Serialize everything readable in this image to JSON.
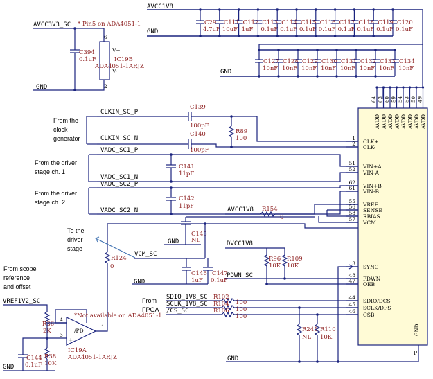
{
  "nets": {
    "avcc3v3_sc": "AVCC3V3_SC",
    "avcc1v8": "AVCC1V8",
    "avcc1v8_2": "AVCC1V8",
    "dvcc1v8": "DVCC1V8",
    "gnd": "GND",
    "clkin_p": "CLKIN_SC_P",
    "clkin_n": "CLKIN_SC_N",
    "vadc1_p": "VADC_SC1_P",
    "vadc1_n": "VADC_SC1_N",
    "vadc2_p": "VADC_SC2_P",
    "vadc2_n": "VADC_SC2_N",
    "vcm_sc": "VCM_SC",
    "pdwn_sc": "PDWN_SC",
    "sdio": "SDIO_1V8_SC",
    "sclk": "SCLK_1V8_SC",
    "cs": "/CS_SC",
    "vref1v2": "VREF1V2_SC"
  },
  "notes": {
    "pin5": "* Pin5 on ADA4051-1",
    "not_available": "*Not available on ADA4051-1",
    "clock_gen": [
      "From the",
      "clock",
      "generator"
    ],
    "driver1": [
      "From the driver",
      "stage ch. 1"
    ],
    "driver2": [
      "From the driver",
      "stage ch. 2"
    ],
    "to_driver": [
      "To the",
      "driver",
      "stage"
    ],
    "scope": [
      "From scope",
      "reference",
      "and offset"
    ],
    "fpga": [
      "From",
      "FPGA"
    ]
  },
  "ic19b": {
    "ref": "IC19B",
    "part": "ADA4051-1ARJZ",
    "pin_top": "6",
    "pin_bot": "2",
    "vplus": "V+",
    "vminus": "V-"
  },
  "ic19a": {
    "ref": "IC19A",
    "part": "ADA4051-1ARJZ",
    "pin_in_neg": "4",
    "pin_in_pos": "3",
    "pin_out": "1",
    "pin_pd": "/PD"
  },
  "caps_top": [
    {
      "ref": "C29",
      "val": "4.7uF"
    },
    {
      "ref": "C111",
      "val": "10uF"
    },
    {
      "ref": "C112",
      "val": "1uF"
    },
    {
      "ref": "C113",
      "val": "0.1uF"
    },
    {
      "ref": "C114",
      "val": "0.1uF"
    },
    {
      "ref": "C115",
      "val": "0.1uF"
    },
    {
      "ref": "C116",
      "val": "0.1uF"
    },
    {
      "ref": "C117",
      "val": "0.1uF"
    },
    {
      "ref": "C118",
      "val": "0.1uF"
    },
    {
      "ref": "C119",
      "val": "0.1uF"
    },
    {
      "ref": "C120",
      "val": "0.1uF"
    }
  ],
  "caps_bot": [
    {
      "ref": "C127",
      "val": "10nF"
    },
    {
      "ref": "C128",
      "val": "10nF"
    },
    {
      "ref": "C129",
      "val": "10nF"
    },
    {
      "ref": "C130",
      "val": "10nF"
    },
    {
      "ref": "C131",
      "val": "10nF"
    },
    {
      "ref": "C132",
      "val": "10nF"
    },
    {
      "ref": "C133",
      "val": "10nF"
    },
    {
      "ref": "C134",
      "val": "10nF"
    }
  ],
  "parts": {
    "c394": {
      "ref": "C394",
      "val": "0.1uF"
    },
    "c139": {
      "ref": "C139",
      "val": "100pF"
    },
    "c140": {
      "ref": "C140",
      "val": "100pF"
    },
    "r89": {
      "ref": "R89",
      "val": "100"
    },
    "c141": {
      "ref": "C141",
      "val": "11pF"
    },
    "c142": {
      "ref": "C142",
      "val": "11pF"
    },
    "r154": {
      "ref": "R154",
      "val": "0"
    },
    "c145": {
      "ref": "C145",
      "val": "NL"
    },
    "r124": {
      "ref": "R124",
      "val": "0"
    },
    "c146": {
      "ref": "C146",
      "val": "1uF"
    },
    "c147": {
      "ref": "C147",
      "val": "0.1uF"
    },
    "r96": {
      "ref": "R96",
      "val": "10K"
    },
    "r109": {
      "ref": "R109",
      "val": "10K"
    },
    "r102": {
      "ref": "R102",
      "val": "100"
    },
    "r104": {
      "ref": "R104",
      "val": "100"
    },
    "r106": {
      "ref": "R106",
      "val": "100"
    },
    "r241": {
      "ref": "R241",
      "val": "NL"
    },
    "r110": {
      "ref": "R110",
      "val": "10K"
    },
    "r36": {
      "ref": "R36",
      "val": "2K"
    },
    "r38": {
      "ref": "R38",
      "val": "10K"
    },
    "c144": {
      "ref": "C144",
      "val": "0.1uF"
    }
  },
  "adc_top_pins": {
    "numbers": [
      "64",
      "63",
      "60",
      "59",
      "54",
      "53",
      "50",
      "49"
    ],
    "name": "AVDD"
  },
  "adc_pins": [
    {
      "num": "1",
      "name": "CLK+"
    },
    {
      "num": "2",
      "name": "CLK-"
    },
    {
      "num": "51",
      "name": "VIN+A"
    },
    {
      "num": "52",
      "name": "VIN-A"
    },
    {
      "num": "62",
      "name": "VIN+B"
    },
    {
      "num": "61",
      "name": "VIN-B"
    },
    {
      "num": "55",
      "name": "VREF"
    },
    {
      "num": "56",
      "name": "SENSE"
    },
    {
      "num": "58",
      "name": "RBIAS"
    },
    {
      "num": "57",
      "name": "VCM"
    },
    {
      "num": "3",
      "name": "SYNC"
    },
    {
      "num": "48",
      "name": "PDWN"
    },
    {
      "num": "47",
      "name": "OEB"
    },
    {
      "num": "44",
      "name": "SDIO/DCS"
    },
    {
      "num": "45",
      "name": "SCLK/DFS"
    },
    {
      "num": "46",
      "name": "CSB"
    }
  ],
  "adc_gnd": {
    "name": "GND",
    "pin": "P"
  }
}
